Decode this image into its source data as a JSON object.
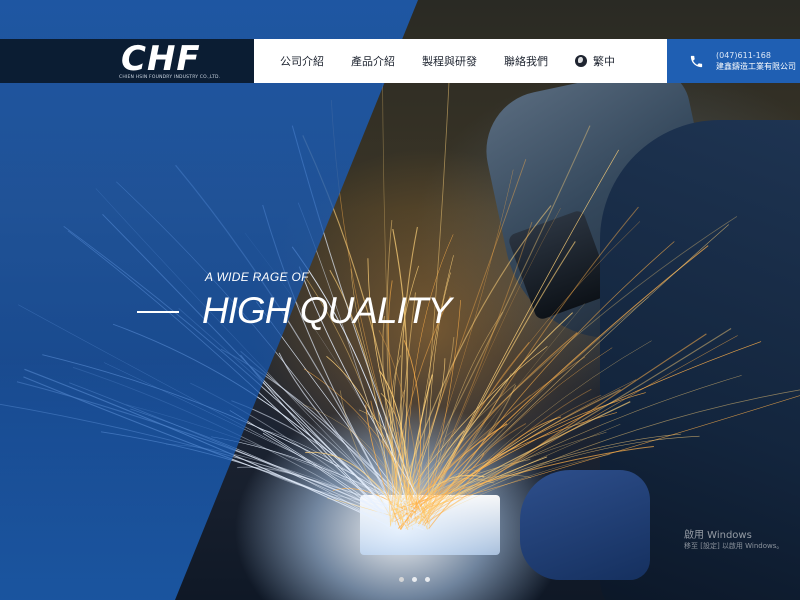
{
  "header": {
    "logo": "CHF",
    "logo_subtitle": "CHIEN HSIN FOUNDRY INDUSTRY CO.,LTD.",
    "nav": [
      {
        "label": "公司介紹"
      },
      {
        "label": "產品介紹"
      },
      {
        "label": "製程與研發"
      },
      {
        "label": "聯絡我們"
      }
    ],
    "language": "繁中",
    "contact": {
      "phone": "(047)611-168",
      "company": "建鑫鑄造工業有限公司"
    }
  },
  "hero": {
    "tagline_small": "A WIDE RAGE OF",
    "tagline_big": "HIGH QUALITY"
  },
  "watermark": {
    "title": "啟用 Windows",
    "subtitle": "移至 [設定] 以啟用 Windows。"
  },
  "icons": {
    "globe": "globe-icon",
    "phone": "phone-icon"
  },
  "colors": {
    "brand_dark": "#0b1d33",
    "accent_blue": "#1f5fb3",
    "overlay_blue": "#1c60be"
  }
}
